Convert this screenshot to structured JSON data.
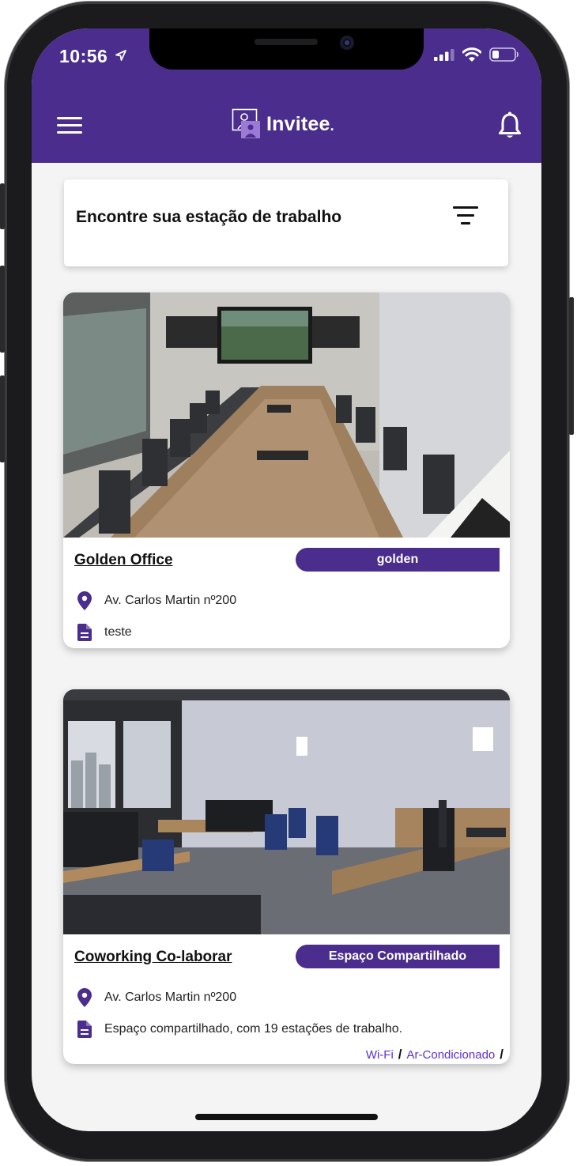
{
  "status_bar": {
    "time": "10:56"
  },
  "header": {
    "app_name": "Invitee",
    "app_name_dot": "."
  },
  "search": {
    "title": "Encontre sua estação de trabalho"
  },
  "spaces": [
    {
      "name": "Golden Office",
      "category": "golden",
      "address": "Av. Carlos Martin nº200",
      "description": "teste",
      "amenities": []
    },
    {
      "name": "Coworking Co-laborar",
      "category": "Espaço Compartilhado",
      "address": "Av. Carlos Martin nº200",
      "description": "Espaço compartilhado, com 19 estações de trabalho.",
      "amenities": [
        "Wi-Fi",
        "Ar-Condicionado"
      ],
      "amenity_separator": "/"
    }
  ],
  "colors": {
    "brand": "#4a2d8c",
    "link": "#5a2fd1",
    "background": "#f4f4f4"
  },
  "icons": [
    "menu-icon",
    "invitee-logo-icon",
    "bell-icon",
    "filter-icon",
    "location-pin-icon",
    "document-icon",
    "signal-icon",
    "wifi-icon",
    "battery-icon",
    "location-arrow-icon"
  ]
}
